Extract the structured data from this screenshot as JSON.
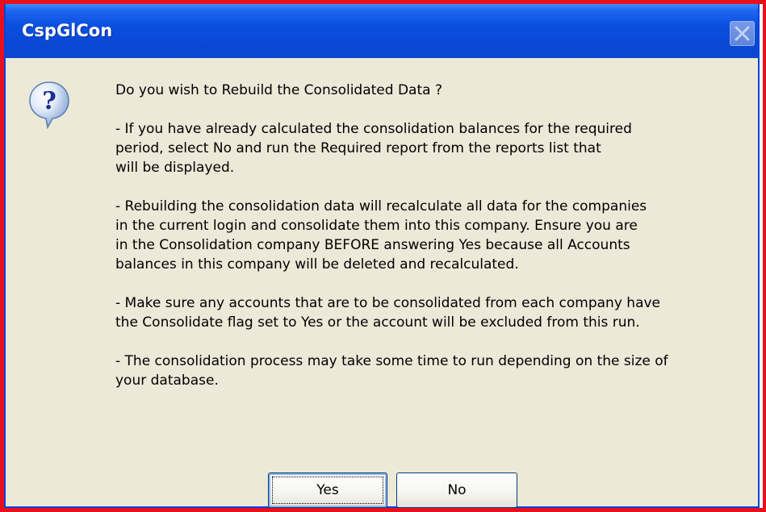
{
  "window": {
    "title": "CspGlCon",
    "close_icon": "close-icon"
  },
  "dialog": {
    "icon": "question-icon",
    "messages": [
      "Do you wish to Rebuild the Consolidated Data ?",
      "- If you have already calculated the consolidation balances for the required\nperiod, select No and run the Required report from the reports list that\nwill be displayed.",
      "- Rebuilding the consolidation data will recalculate all data for the companies\nin the current login and consolidate them into this company. Ensure you are\nin the Consolidation company BEFORE answering Yes because all Accounts\nbalances in this company will be deleted and recalculated.",
      "- Make sure any accounts that are to be consolidated from each company have\nthe Consolidate flag set to Yes or the account will be excluded from this run.",
      "- The consolidation process may take some time to run depending on the size of\nyour database."
    ],
    "buttons": {
      "yes_label": "Yes",
      "no_label": "No"
    }
  },
  "colors": {
    "outline": "#e8101c",
    "titlebar": "#0a4fe0",
    "dialog_bg": "#ece9d8"
  }
}
